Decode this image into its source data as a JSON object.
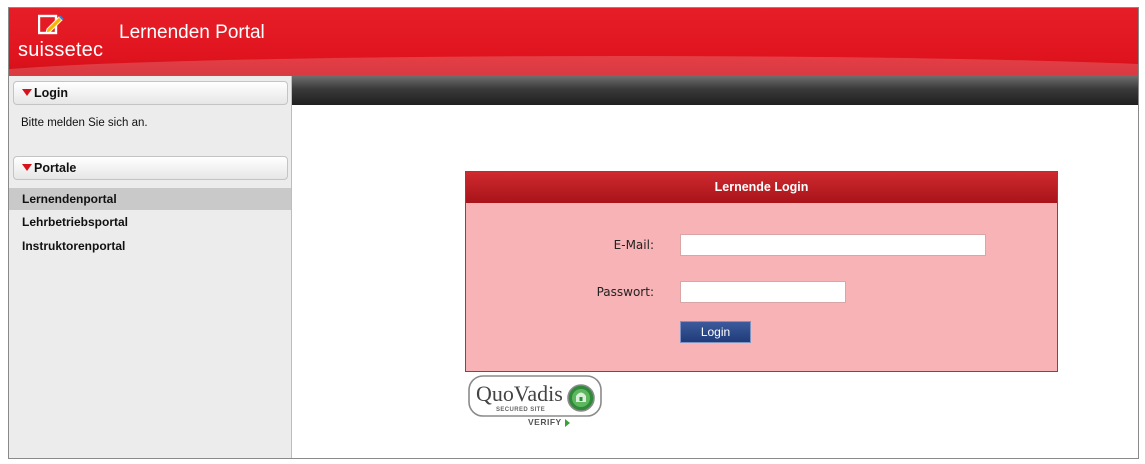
{
  "brand": {
    "logo_text": "suissetec",
    "app_title": "Lernenden Portal"
  },
  "sidebar": {
    "login_section": {
      "title": "Login",
      "hint": "Bitte melden Sie sich an."
    },
    "portals_section": {
      "title": "Portale",
      "items": [
        {
          "label": "Lernendenportal",
          "active": true
        },
        {
          "label": "Lehrbetriebsportal",
          "active": false
        },
        {
          "label": "Instruktorenportal",
          "active": false
        }
      ]
    }
  },
  "login_panel": {
    "title": "Lernende Login",
    "email_label": "E-Mail:",
    "email_value": "",
    "password_label": "Passwort:",
    "password_value": "",
    "submit_label": "Login"
  },
  "seal": {
    "brand": "QuoVadis",
    "subtitle": "SECURED SITE",
    "verify_label": "VERIFY"
  },
  "colors": {
    "brand_red": "#e61e28",
    "panel_bg": "#f8b3b6",
    "panel_header": "#b81c22",
    "button_blue": "#2a4585"
  }
}
